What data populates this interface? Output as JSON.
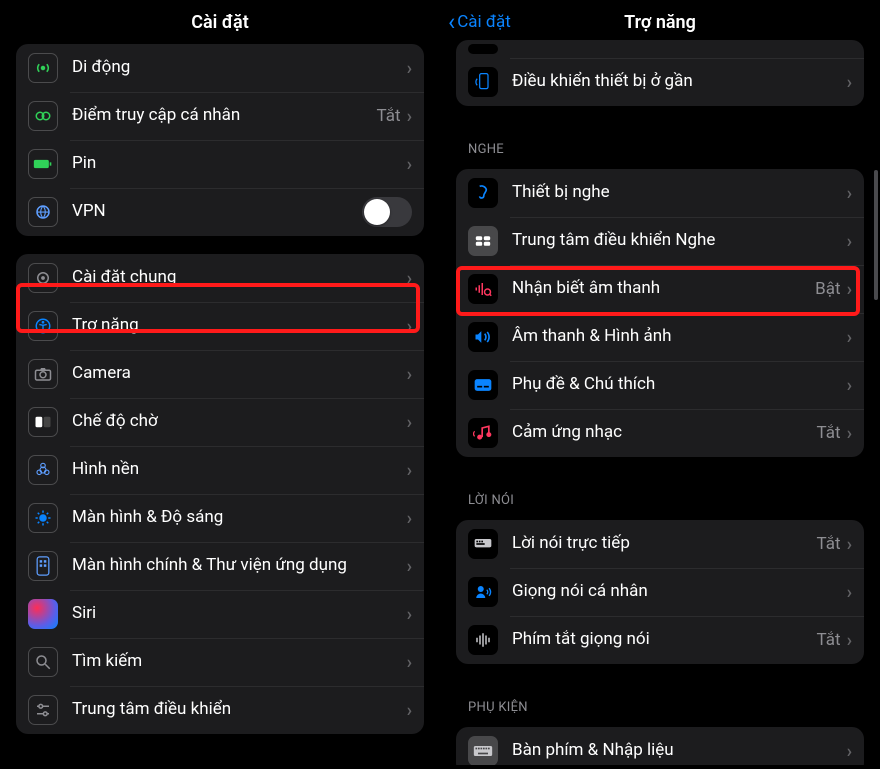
{
  "left": {
    "title": "Cài đặt",
    "group1": [
      {
        "icon": "cellular",
        "label": "Di động",
        "value": ""
      },
      {
        "icon": "hotspot",
        "label": "Điểm truy cập cá nhân",
        "value": "Tắt"
      },
      {
        "icon": "battery",
        "label": "Pin",
        "value": ""
      },
      {
        "icon": "vpn",
        "label": "VPN",
        "value": "",
        "toggle": true
      }
    ],
    "group2": [
      {
        "icon": "general",
        "label": "Cài đặt chung"
      },
      {
        "icon": "accessibility",
        "label": "Trợ năng"
      },
      {
        "icon": "camera",
        "label": "Camera"
      },
      {
        "icon": "standby",
        "label": "Chế độ chờ"
      },
      {
        "icon": "wallpaper",
        "label": "Hình nền"
      },
      {
        "icon": "display",
        "label": "Màn hình & Độ sáng"
      },
      {
        "icon": "homescreen",
        "label": "Màn hình chính & Thư viện ứng dụng"
      },
      {
        "icon": "siri",
        "label": "Siri"
      },
      {
        "icon": "search",
        "label": "Tìm kiếm"
      },
      {
        "icon": "controlcenter",
        "label": "Trung tâm điều khiển"
      }
    ]
  },
  "right": {
    "back": "Cài đặt",
    "title": "Trợ năng",
    "group0": [
      {
        "icon": "nearby",
        "label": "Điều khiển thiết bị ở gần"
      }
    ],
    "sections": [
      {
        "header": "NGHE",
        "items": [
          {
            "icon": "hearing",
            "label": "Thiết bị nghe",
            "value": ""
          },
          {
            "icon": "hearingcc",
            "label": "Trung tâm điều khiển Nghe",
            "value": ""
          },
          {
            "icon": "soundrec",
            "label": "Nhận biết âm thanh",
            "value": "Bật"
          },
          {
            "icon": "audiovisual",
            "label": "Âm thanh & Hình ảnh",
            "value": ""
          },
          {
            "icon": "subtitles",
            "label": "Phụ đề & Chú thích",
            "value": ""
          },
          {
            "icon": "haptic",
            "label": "Cảm ứng nhạc",
            "value": "Tắt"
          }
        ]
      },
      {
        "header": "LỜI NÓI",
        "items": [
          {
            "icon": "livespeech",
            "label": "Lời nói trực tiếp",
            "value": "Tắt"
          },
          {
            "icon": "personalvoice",
            "label": "Giọng nói cá nhân",
            "value": ""
          },
          {
            "icon": "voiceshortcut",
            "label": "Phím tắt giọng nói",
            "value": "Tắt"
          }
        ]
      },
      {
        "header": "PHỤ KIỆN",
        "items": [
          {
            "icon": "keyboard",
            "label": "Bàn phím & Nhập liệu",
            "value": ""
          }
        ]
      }
    ]
  }
}
